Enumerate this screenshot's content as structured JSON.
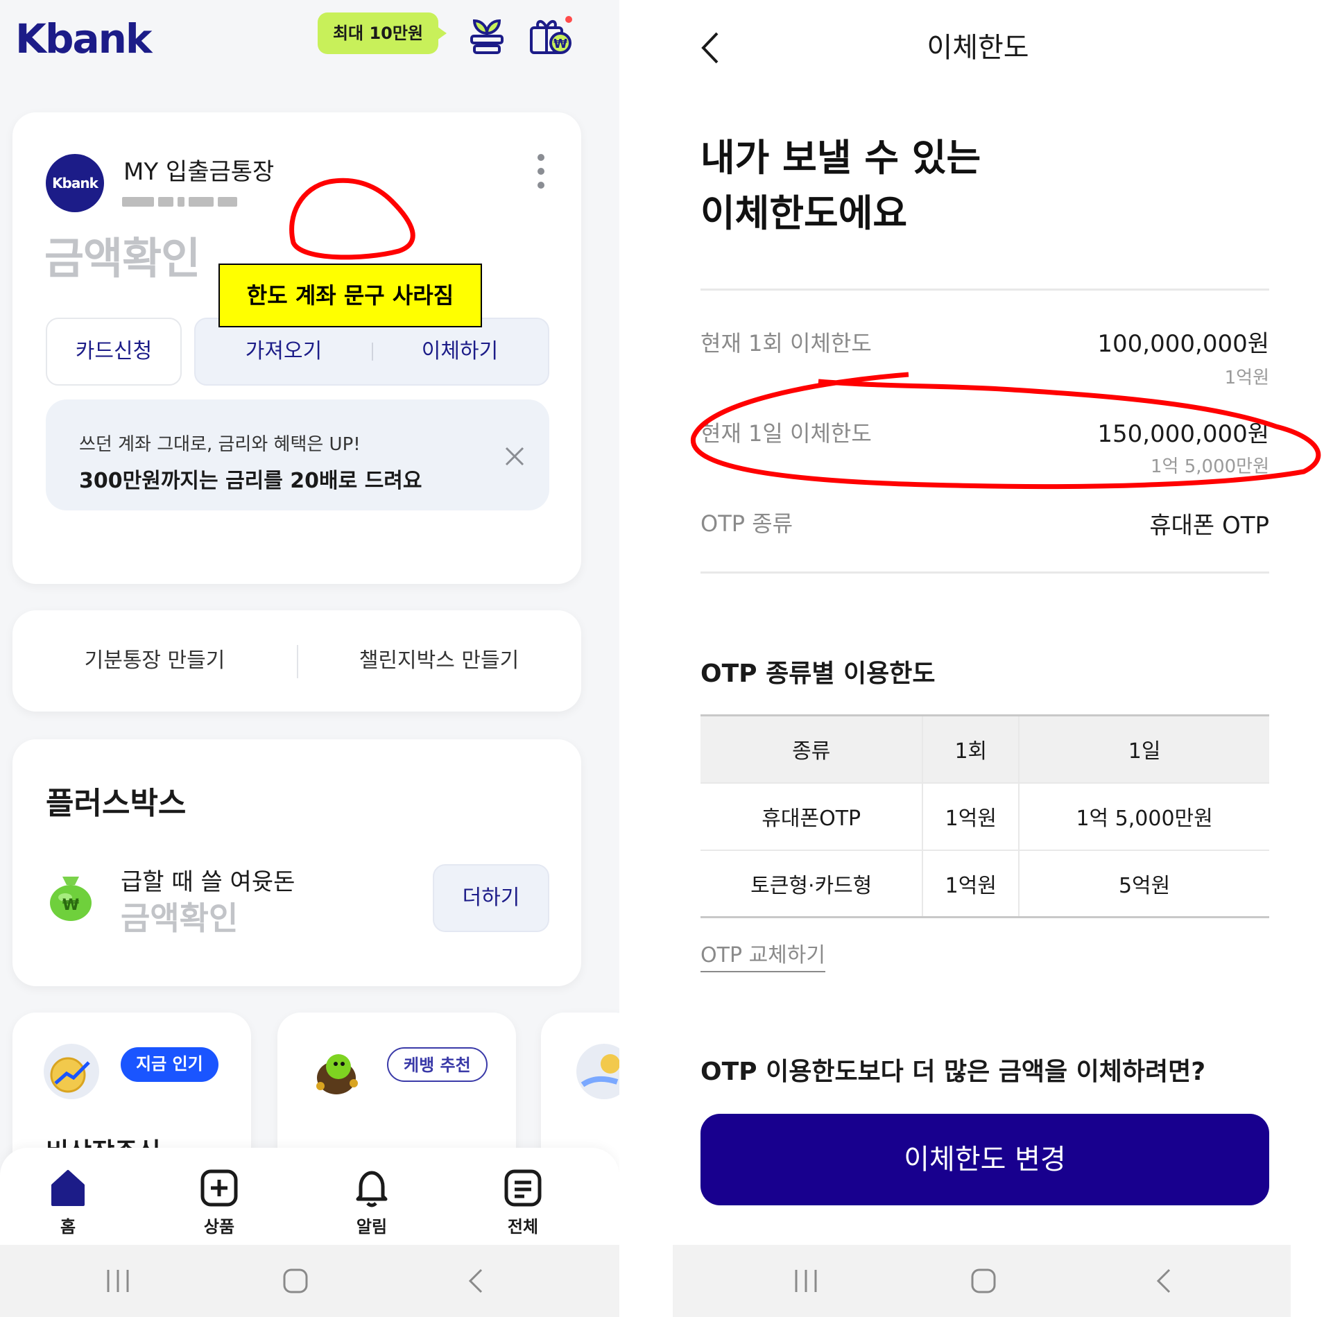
{
  "left": {
    "header": {
      "logo": "Kbank",
      "promo_badge": "최대 10만원",
      "icons": [
        "sprout-icon",
        "gift-won-icon"
      ]
    },
    "account_card": {
      "bank_logo": "Kbank",
      "account_name": "MY 입출금통장",
      "account_number_masked": "***-***",
      "amount": "금액확인",
      "buttons": {
        "card_apply": "카드신청",
        "bring": "가져오기",
        "transfer": "이체하기"
      },
      "banner": {
        "subtitle": "쓰던 계좌 그대로, 금리와 혜택은 UP!",
        "title": "300만원까지는 금리를 20배로 드려요"
      }
    },
    "annotation": {
      "note": "한도 계좌 문구 사라짐"
    },
    "quick_actions": {
      "mood_account": "기분통장 만들기",
      "challenge_box": "챌린지박스 만들기"
    },
    "plus_box": {
      "title": "플러스박스",
      "subtitle": "급할 때 쓸 여윳돈",
      "amount": "금액확인",
      "add_button": "더하기"
    },
    "cards": [
      {
        "chip": "지금 인기",
        "title": "비상장주식"
      },
      {
        "chip": "케뱅 추천",
        "title": ""
      }
    ],
    "bottom_nav": [
      {
        "label": "홈",
        "icon": "home-icon"
      },
      {
        "label": "상품",
        "icon": "plus-square-icon"
      },
      {
        "label": "알림",
        "icon": "bell-icon"
      },
      {
        "label": "전체",
        "icon": "menu-list-icon"
      }
    ]
  },
  "right": {
    "header": {
      "title": "이체한도"
    },
    "heading": {
      "line1": "내가 보낼 수 있는",
      "line2": "이체한도에요"
    },
    "limits": [
      {
        "label": "현재 1회 이체한도",
        "value": "100,000,000원",
        "sub": "1억원"
      },
      {
        "label": "현재 1일 이체한도",
        "value": "150,000,000원",
        "sub": "1억 5,000만원"
      },
      {
        "label": "OTP 종류",
        "value": "휴대폰 OTP",
        "sub": ""
      }
    ],
    "otp_section": {
      "title": "OTP 종류별 이용한도",
      "headers": [
        "종류",
        "1회",
        "1일"
      ],
      "rows": [
        [
          "휴대폰OTP",
          "1억원",
          "1억 5,000만원"
        ],
        [
          "토큰형·카드형",
          "1억원",
          "5억원"
        ]
      ],
      "replace_link": "OTP 교체하기"
    },
    "more_section": {
      "title": "OTP 이용한도보다 더 많은 금액을 이체하려면?",
      "button": "이체한도 변경"
    }
  },
  "colors": {
    "brand_navy": "#1c1c88",
    "cta_indigo": "#18008e",
    "promo_green": "#c8f05a",
    "annotation_red": "#ff0000",
    "annotation_yellow": "#ffff00",
    "chip_blue": "#1a55ff"
  }
}
